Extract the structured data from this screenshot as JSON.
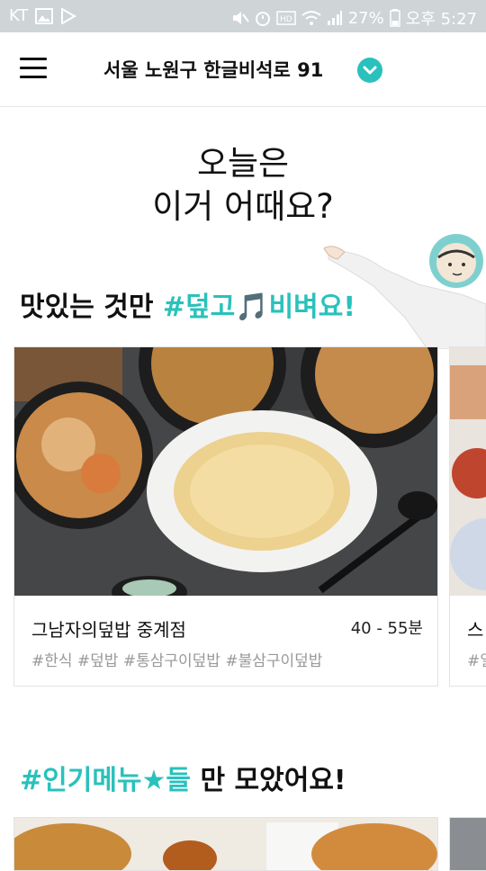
{
  "status_bar": {
    "carrier": "KT",
    "battery": "27%",
    "time": "오후 5:27"
  },
  "app_bar": {
    "address": "서울 노원구 한글비석로 91"
  },
  "headline": {
    "line1": "오늘은",
    "line2": "이거 어때요?"
  },
  "section1": {
    "title_prefix": "맛있는 것만 ",
    "title_accent": "#덮고🎵비벼요!"
  },
  "restaurant_card": {
    "name": "그남자의덮밥 중계점",
    "delivery_time": "40 - 55분",
    "tags": "#한식 #덮밥 #통삼구이덮밥 #불삼구이덮밥"
  },
  "peek_card": {
    "name": "스",
    "tag": "#일"
  },
  "section2": {
    "title_accent": "#인기메뉴★들",
    "title_suffix": " 만 모았어요!"
  },
  "colors": {
    "accent": "#2ac1bc",
    "status_bar": "#cfd4d6"
  }
}
